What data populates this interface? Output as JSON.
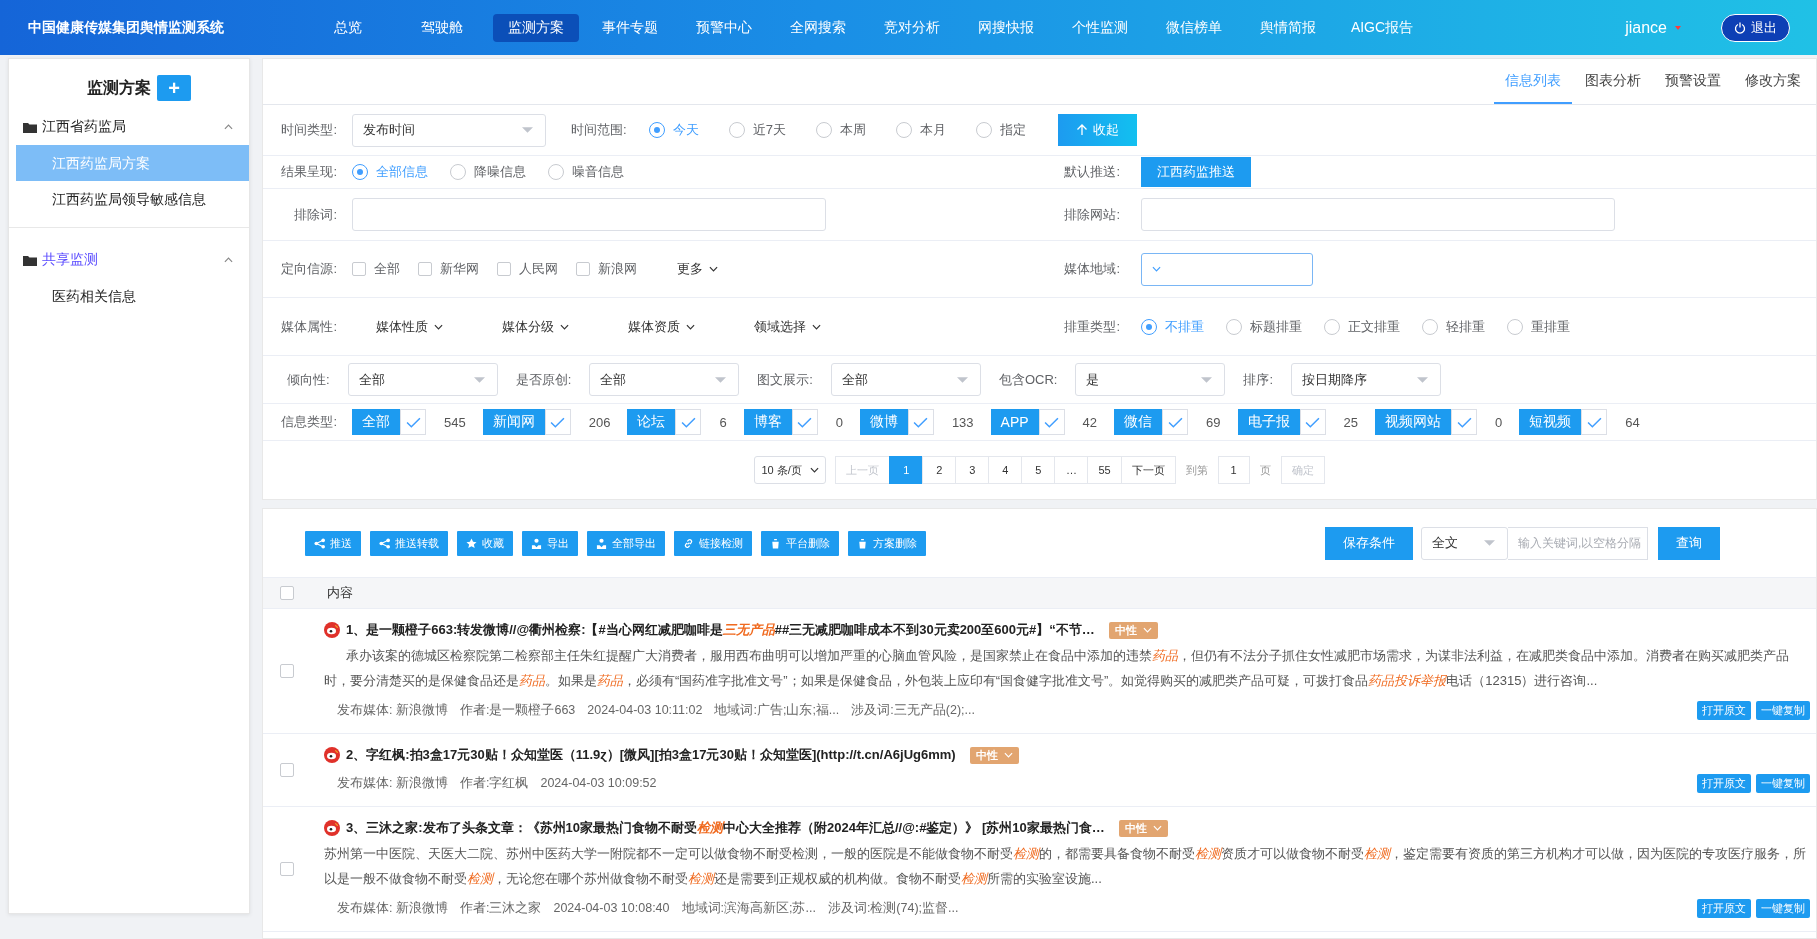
{
  "header": {
    "title": "中国健康传媒集团舆情监测系统",
    "nav": [
      {
        "label": "总览",
        "selected": false
      },
      {
        "label": "驾驶舱",
        "selected": false
      },
      {
        "label": "监测方案",
        "selected": true
      },
      {
        "label": "事件专题",
        "selected": false
      },
      {
        "label": "预警中心",
        "selected": false
      },
      {
        "label": "全网搜索",
        "selected": false
      },
      {
        "label": "竞对分析",
        "selected": false
      },
      {
        "label": "网搜快报",
        "selected": false
      },
      {
        "label": "个性监测",
        "selected": false
      },
      {
        "label": "微信榜单",
        "selected": false
      },
      {
        "label": "舆情简报",
        "selected": false
      },
      {
        "label": "AIGC报告",
        "selected": false
      }
    ],
    "user": "jiance",
    "logout": "退出"
  },
  "sidebar": {
    "title": "监测方案",
    "add": "+",
    "groups": [
      {
        "label": "江西省药监局",
        "selected": false,
        "expanded": true,
        "children": [
          {
            "label": "江西药监局方案",
            "selected": true
          },
          {
            "label": "江西药监局领导敏感信息",
            "selected": false
          }
        ]
      },
      {
        "label": "共享监测",
        "selected": true,
        "expanded": true,
        "children": [
          {
            "label": "医药相关信息",
            "selected": false
          }
        ]
      }
    ]
  },
  "tabs": [
    {
      "label": "信息列表",
      "selected": true
    },
    {
      "label": "图表分析",
      "selected": false
    },
    {
      "label": "预警设置",
      "selected": false
    },
    {
      "label": "修改方案",
      "selected": false
    }
  ],
  "filters": {
    "time_type": {
      "label": "时间类型:",
      "value": "发布时间"
    },
    "time_range": {
      "label": "时间范围:",
      "options": [
        {
          "label": "今天",
          "selected": true
        },
        {
          "label": "近7天",
          "selected": false
        },
        {
          "label": "本周",
          "selected": false
        },
        {
          "label": "本月",
          "selected": false
        },
        {
          "label": "指定",
          "selected": false
        }
      ]
    },
    "collapse": "收起",
    "result": {
      "label": "结果呈现:",
      "options": [
        {
          "label": "全部信息",
          "selected": true
        },
        {
          "label": "降噪信息",
          "selected": false
        },
        {
          "label": "噪音信息",
          "selected": false
        }
      ]
    },
    "default_push": {
      "label": "默认推送:",
      "button": "江西药监推送"
    },
    "exclude_words": {
      "label": "排除词:"
    },
    "exclude_sites": {
      "label": "排除网站:"
    },
    "sources": {
      "label": "定向信源:",
      "options": [
        {
          "label": "全部",
          "checked": false
        },
        {
          "label": "新华网",
          "checked": false
        },
        {
          "label": "人民网",
          "checked": false
        },
        {
          "label": "新浪网",
          "checked": false
        }
      ],
      "more": "更多"
    },
    "media_region": {
      "label": "媒体地域:"
    },
    "media_attrs": {
      "label": "媒体属性:",
      "dropdowns": [
        "媒体性质",
        "媒体分级",
        "媒体资质",
        "领域选择"
      ]
    },
    "dedup": {
      "label": "排重类型:",
      "options": [
        {
          "label": "不排重",
          "selected": true
        },
        {
          "label": "标题排重",
          "selected": false
        },
        {
          "label": "正文排重",
          "selected": false
        },
        {
          "label": "轻排重",
          "selected": false
        },
        {
          "label": "重排重",
          "selected": false
        }
      ]
    },
    "selects": [
      {
        "label": "倾向性:",
        "value": "全部"
      },
      {
        "label": "是否原创:",
        "value": "全部"
      },
      {
        "label": "图文展示:",
        "value": "全部"
      },
      {
        "label": "包含OCR:",
        "value": "是"
      },
      {
        "label": "排序:",
        "value": "按日期降序"
      }
    ],
    "info_types": {
      "label": "信息类型:",
      "items": [
        {
          "label": "全部",
          "checked": true,
          "count": "545"
        },
        {
          "label": "新闻网",
          "checked": true,
          "count": "206"
        },
        {
          "label": "论坛",
          "checked": true,
          "count": "6"
        },
        {
          "label": "博客",
          "checked": true,
          "count": "0"
        },
        {
          "label": "微博",
          "checked": true,
          "count": "133"
        },
        {
          "label": "APP",
          "checked": true,
          "count": "42"
        },
        {
          "label": "微信",
          "checked": true,
          "count": "69"
        },
        {
          "label": "电子报",
          "checked": true,
          "count": "25"
        },
        {
          "label": "视频网站",
          "checked": true,
          "count": "0"
        },
        {
          "label": "短视频",
          "checked": true,
          "count": "64"
        }
      ]
    }
  },
  "pagination": {
    "per_page": "10 条/页",
    "prev": {
      "label": "上一页",
      "disabled": true
    },
    "pages": [
      {
        "label": "1",
        "selected": true
      },
      {
        "label": "2",
        "selected": false
      },
      {
        "label": "3",
        "selected": false
      },
      {
        "label": "4",
        "selected": false
      },
      {
        "label": "5",
        "selected": false
      },
      {
        "label": "…",
        "selected": false
      },
      {
        "label": "55",
        "selected": false
      }
    ],
    "next": {
      "label": "下一页",
      "disabled": false
    },
    "goto": "到第",
    "page_value": "1",
    "page_unit": "页",
    "confirm": "确定"
  },
  "toolbar": {
    "actions": [
      "推送",
      "推送转载",
      "收藏",
      "导出",
      "全部导出",
      "链接检测",
      "平台删除",
      "方案删除"
    ],
    "save": "保存条件",
    "scope": "全文",
    "search_placeholder": "输入关键词,以空格分隔",
    "query": "查询"
  },
  "table": {
    "header_checked": false,
    "column": "内容",
    "rows": [
      {
        "checked": false,
        "title": [
          {
            "text": "1、是一颗橙子663:转发微博//@衢州检察:【#当心网红减肥咖啡是",
            "highlight": false
          },
          {
            "text": "三无产品",
            "highlight": true
          },
          {
            "text": "##三无减肥咖啡成本不到30元卖200至600元#】“不节…",
            "highlight": false
          }
        ],
        "sentiment": "中性",
        "indent": true,
        "body": [
          {
            "text": "承办该案的德城区检察院第二检察部主任朱红提醒广大消费者，服用西布曲明可以增加严重的心脑血管风险，是国家禁止在食品中添加的违禁",
            "highlight": false
          },
          {
            "text": "药品",
            "highlight": true
          },
          {
            "text": "，但仍有不法分子抓住女性减肥市场需求，为谋非法利益，在减肥类食品中添加。消费者在购买减肥类产品时，要分清楚买的是保健食品还是",
            "highlight": false
          },
          {
            "text": "药品",
            "highlight": true
          },
          {
            "text": "。如果是",
            "highlight": false
          },
          {
            "text": "药品",
            "highlight": true
          },
          {
            "text": "，必须有“国药准字批准文号”；如果是保健食品，外包装上应印有“国食健字批准文号”。如觉得购买的减肥类产品可疑，可拨打食品",
            "highlight": false
          },
          {
            "text": "药品投诉举报",
            "highlight": true
          },
          {
            "text": "电话（12315）进行咨询...",
            "highlight": false
          }
        ],
        "meta": [
          "发布媒体: 新浪微博",
          "作者:是一颗橙子663",
          "2024-04-03 10:11:02",
          "地域词:广告;山东;福...",
          "涉及词:三无产品(2);..."
        ],
        "actions": [
          "打开原文",
          "一键复制"
        ]
      },
      {
        "checked": false,
        "title": [
          {
            "text": "2、字红枫:拍3盒17元30贴！众知堂医（11.9ɀ）[微风][拍3盒17元30贴！众知堂医](http://t.cn/A6jUg6mm)",
            "highlight": false
          }
        ],
        "sentiment": "中性",
        "meta": [
          "发布媒体: 新浪微博",
          "作者:字红枫",
          "2024-04-03 10:09:52"
        ],
        "actions": [
          "打开原文",
          "一键复制"
        ]
      },
      {
        "checked": false,
        "title": [
          {
            "text": "3、三沐之家:发布了头条文章：《苏州10家最热门食物不耐受",
            "highlight": false
          },
          {
            "text": "检测",
            "highlight": true
          },
          {
            "text": "中心大全推荐（附2024年汇总//@:#鉴定）》 [苏州10家最热门食…",
            "highlight": false
          }
        ],
        "sentiment": "中性",
        "indent": false,
        "body": [
          {
            "text": "苏州第一中医院、天医大二院、苏州中医药大学一附院都不一定可以做食物不耐受检测，一般的医院是不能做食物不耐受",
            "highlight": false
          },
          {
            "text": "检测",
            "highlight": true
          },
          {
            "text": "的，都需要具备食物不耐受",
            "highlight": false
          },
          {
            "text": "检测",
            "highlight": true
          },
          {
            "text": "资质才可以做食物不耐受",
            "highlight": false
          },
          {
            "text": "检测",
            "highlight": true
          },
          {
            "text": "，鉴定需要有资质的第三方机构才可以做，因为医院的专攻医疗服务，所以是一般不做食物不耐受",
            "highlight": false
          },
          {
            "text": "检测",
            "highlight": true
          },
          {
            "text": "，无论您在哪个苏州做食物不耐受",
            "highlight": false
          },
          {
            "text": "检测",
            "highlight": true
          },
          {
            "text": "还是需要到正规权威的机构做。食物不耐受",
            "highlight": false
          },
          {
            "text": "检测",
            "highlight": true
          },
          {
            "text": "所需的实验室设施...",
            "highlight": false
          }
        ],
        "meta": [
          "发布媒体: 新浪微博",
          "作者:三沐之家",
          "2024-04-03 10:08:40",
          "地域词:滨海高新区;苏...",
          "涉及词:检测(74);监督..."
        ],
        "actions": [
          "打开原文",
          "一键复制"
        ]
      }
    ]
  }
}
